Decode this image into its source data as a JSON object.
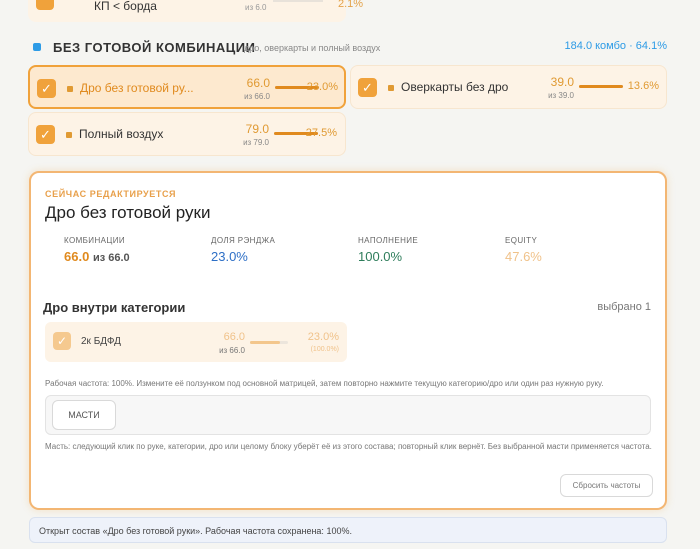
{
  "top_card": {
    "label": "КП < борда",
    "sub": "из 6.0",
    "pct": "2.1%"
  },
  "section": {
    "title": "БЕЗ ГОТОВОЙ КОМБИНАЦИИ",
    "description": "дро, оверкарты и полный воздух",
    "summary": "184.0 комбо · 64.1%"
  },
  "combos": [
    {
      "name": "Дро без готовой ру...",
      "value": "66.0",
      "of": "из 66.0",
      "pct": "23.0%",
      "fill": 1.0,
      "selected": true
    },
    {
      "name": "Оверкарты без дро",
      "value": "39.0",
      "of": "из 39.0",
      "pct": "13.6%",
      "fill": 1.0,
      "selected": false
    },
    {
      "name": "Полный воздух",
      "value": "79.0",
      "of": "из 79.0",
      "pct": "27.5%",
      "fill": 1.0,
      "selected": false
    }
  ],
  "editor": {
    "label": "СЕЙЧАС РЕДАКТИРУЕТСЯ",
    "title": "Дро без готовой руки",
    "stats": {
      "combos_key": "КОМБИНАЦИИ",
      "combos_val": "66.0",
      "combos_of": "из 66.0",
      "range_key": "ДОЛЯ РЭНДЖА",
      "range_val": "23.0%",
      "fill_key": "НАПОЛНЕНИЕ",
      "fill_val": "100.0%",
      "equity_key": "EQUITY",
      "equity_val": "47.6%"
    },
    "subsection_title": "Дро внутри категории",
    "selected_count": "выбрано 1",
    "hand": {
      "name": "2к БДФД",
      "value": "66.0",
      "of": "из 66.0",
      "pct": "23.0%",
      "pct_sub": "(100.0%)",
      "fill": 0.8
    },
    "note_freq": "Рабочая частота: 100%. Измените её ползунком под основной матрицей, затем повторно нажмите текущую категорию/дро или один раз нужную руку.",
    "suits_button": "МАСТИ",
    "note_suits": "Масть: следующий клик по руке, категории, дро или целому блоку уберёт её из этого состава; повторный клик вернёт. Без выбранной масти применяется частота.",
    "reset_button": "Сбросить частоты"
  },
  "status": "Открыт состав «Дро без готовой руки». Рабочая частота сохранена: 100%.",
  "colors": {
    "accent": "#f0a23b",
    "blue": "#2d9be6",
    "green": "#2e7d5b",
    "equity": "#f0c28a"
  }
}
